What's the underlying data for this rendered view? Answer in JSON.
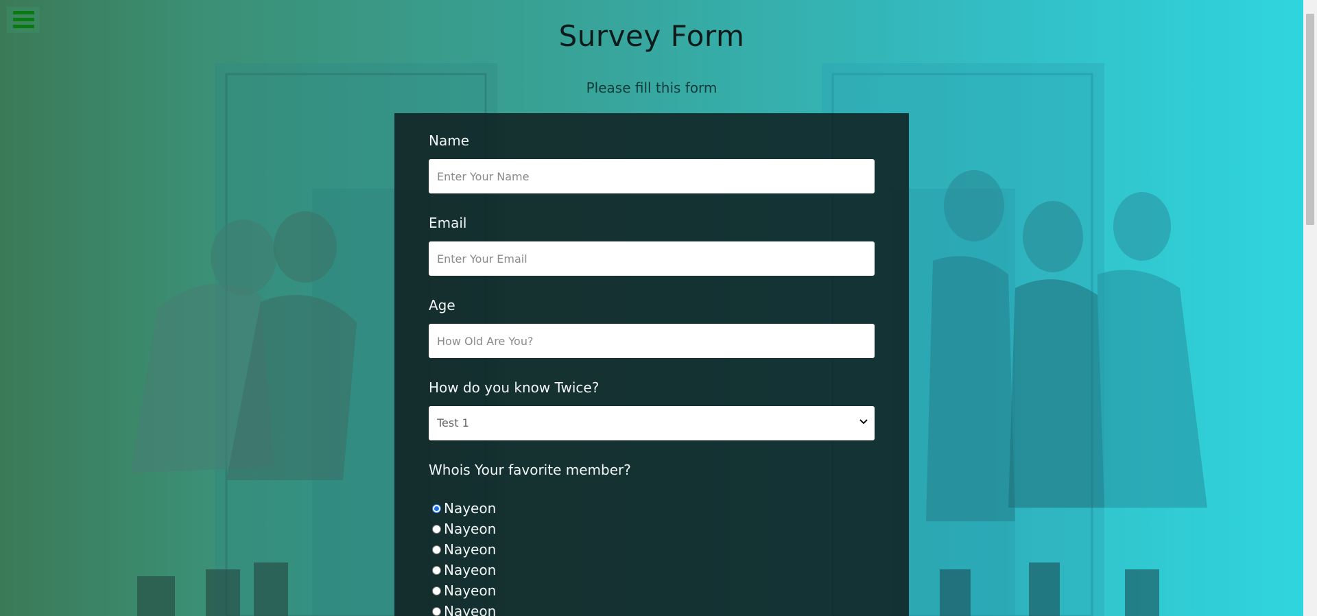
{
  "header": {
    "title": "Survey Form",
    "subtitle": "Please fill this form"
  },
  "menu": {
    "icon": "hamburger-menu-icon"
  },
  "form": {
    "name_label": "Name",
    "name_placeholder": "Enter Your Name",
    "email_label": "Email",
    "email_placeholder": "Enter Your Email",
    "age_label": "Age",
    "age_placeholder": "How Old Are You?",
    "know_label": "How do you know Twice?",
    "know_selected": "Test 1",
    "favorite_label": "Whois Your favorite member?",
    "members": [
      {
        "label": "Nayeon",
        "checked": true
      },
      {
        "label": "Nayeon",
        "checked": false
      },
      {
        "label": "Nayeon",
        "checked": false
      },
      {
        "label": "Nayeon",
        "checked": false
      },
      {
        "label": "Nayeon",
        "checked": false
      },
      {
        "label": "Nayeon",
        "checked": false
      }
    ]
  },
  "colors": {
    "accent": "#0a7a10",
    "card": "#0f1e20",
    "radio_checked": "#1a73e8"
  }
}
